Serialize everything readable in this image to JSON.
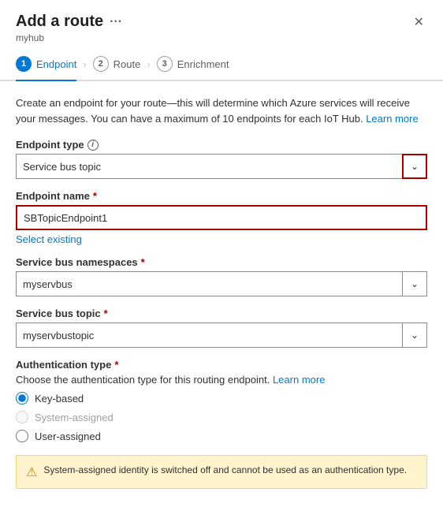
{
  "header": {
    "title": "Add a route",
    "subtitle": "myhub",
    "ellipsis_label": "···",
    "close_label": "✕"
  },
  "steps": [
    {
      "number": "1",
      "label": "Endpoint",
      "state": "active"
    },
    {
      "number": "2",
      "label": "Route",
      "state": "inactive"
    },
    {
      "number": "3",
      "label": "Enrichment",
      "state": "inactive"
    }
  ],
  "description": "Create an endpoint for your route—this will determine which Azure services will receive your messages. You can have a maximum of 10 endpoints for each IoT Hub.",
  "learn_more_label": "Learn more",
  "endpoint_type": {
    "label": "Endpoint type",
    "value": "Service bus topic",
    "required": false
  },
  "endpoint_name": {
    "label": "Endpoint name",
    "value": "SBTopicEndpoint1",
    "required": true,
    "select_existing": "Select existing"
  },
  "service_bus_namespaces": {
    "label": "Service bus namespaces",
    "value": "myservbus",
    "required": true
  },
  "service_bus_topic": {
    "label": "Service bus topic",
    "value": "myservbustopic",
    "required": true
  },
  "auth_type": {
    "label": "Authentication type",
    "required": true,
    "description": "Choose the authentication type for this routing endpoint.",
    "learn_more_label": "Learn more",
    "options": [
      {
        "id": "key-based",
        "label": "Key-based",
        "checked": true,
        "disabled": false
      },
      {
        "id": "system-assigned",
        "label": "System-assigned",
        "checked": false,
        "disabled": true
      },
      {
        "id": "user-assigned",
        "label": "User-assigned",
        "checked": false,
        "disabled": false
      }
    ]
  },
  "warning": {
    "icon": "⚠",
    "text": "System-assigned identity is switched off and cannot be used as an authentication type."
  }
}
